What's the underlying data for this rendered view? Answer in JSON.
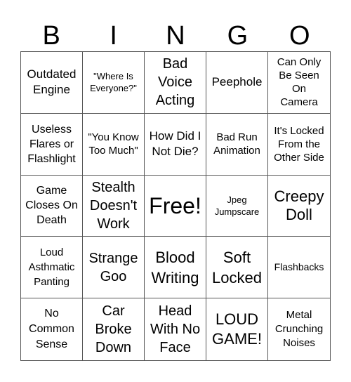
{
  "header": [
    "B",
    "I",
    "N",
    "G",
    "O"
  ],
  "cells": [
    "Outdated Engine",
    "\"Where Is Everyone?\"",
    "Bad Voice Acting",
    "Peephole",
    "Can Only Be Seen On Camera",
    "Useless Flares or Flashlight",
    "\"You Know Too Much\"",
    "How Did I Not Die?",
    "Bad Run Animation",
    "It's Locked From the Other Side",
    "Game Closes On Death",
    "Stealth Doesn't Work",
    "Free!",
    "Jpeg Jumpscare",
    "Creepy Doll",
    "Loud Asthmatic Panting",
    "Strange Goo",
    "Blood Writing",
    "Soft Locked",
    "Flashbacks",
    "No Common Sense",
    "Car Broke Down",
    "Head With No Face",
    "LOUD GAME!",
    "Metal Crunching Noises"
  ]
}
